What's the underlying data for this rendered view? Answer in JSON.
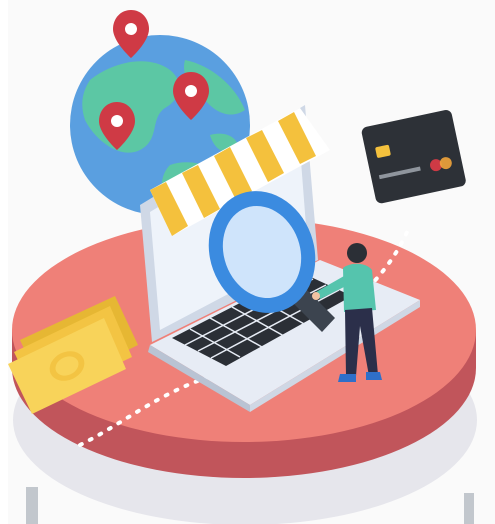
{
  "illustration": {
    "subject": "online-shopping-search",
    "icons": [
      "globe-icon",
      "location-pin-icon",
      "laptop-icon",
      "shop-awning-icon",
      "magnifier-icon",
      "credit-card-icon",
      "cash-icon",
      "person-icon"
    ]
  },
  "colors": {
    "platform_top": "#ef7f78",
    "platform_side": "#c65a5e",
    "platform_shadow": "#dfdfe6",
    "globe_water": "#5a9fe0",
    "globe_land": "#5cc7a4",
    "pin": "#cf3a45",
    "laptop": "#dfe7f3",
    "awning_yellow": "#f4c13d",
    "magnifier": "#3b8be0",
    "card": "#2d3137",
    "cash": "#f8d35a",
    "person_top": "#55c4ad",
    "person_pants": "#2b2f4a"
  }
}
